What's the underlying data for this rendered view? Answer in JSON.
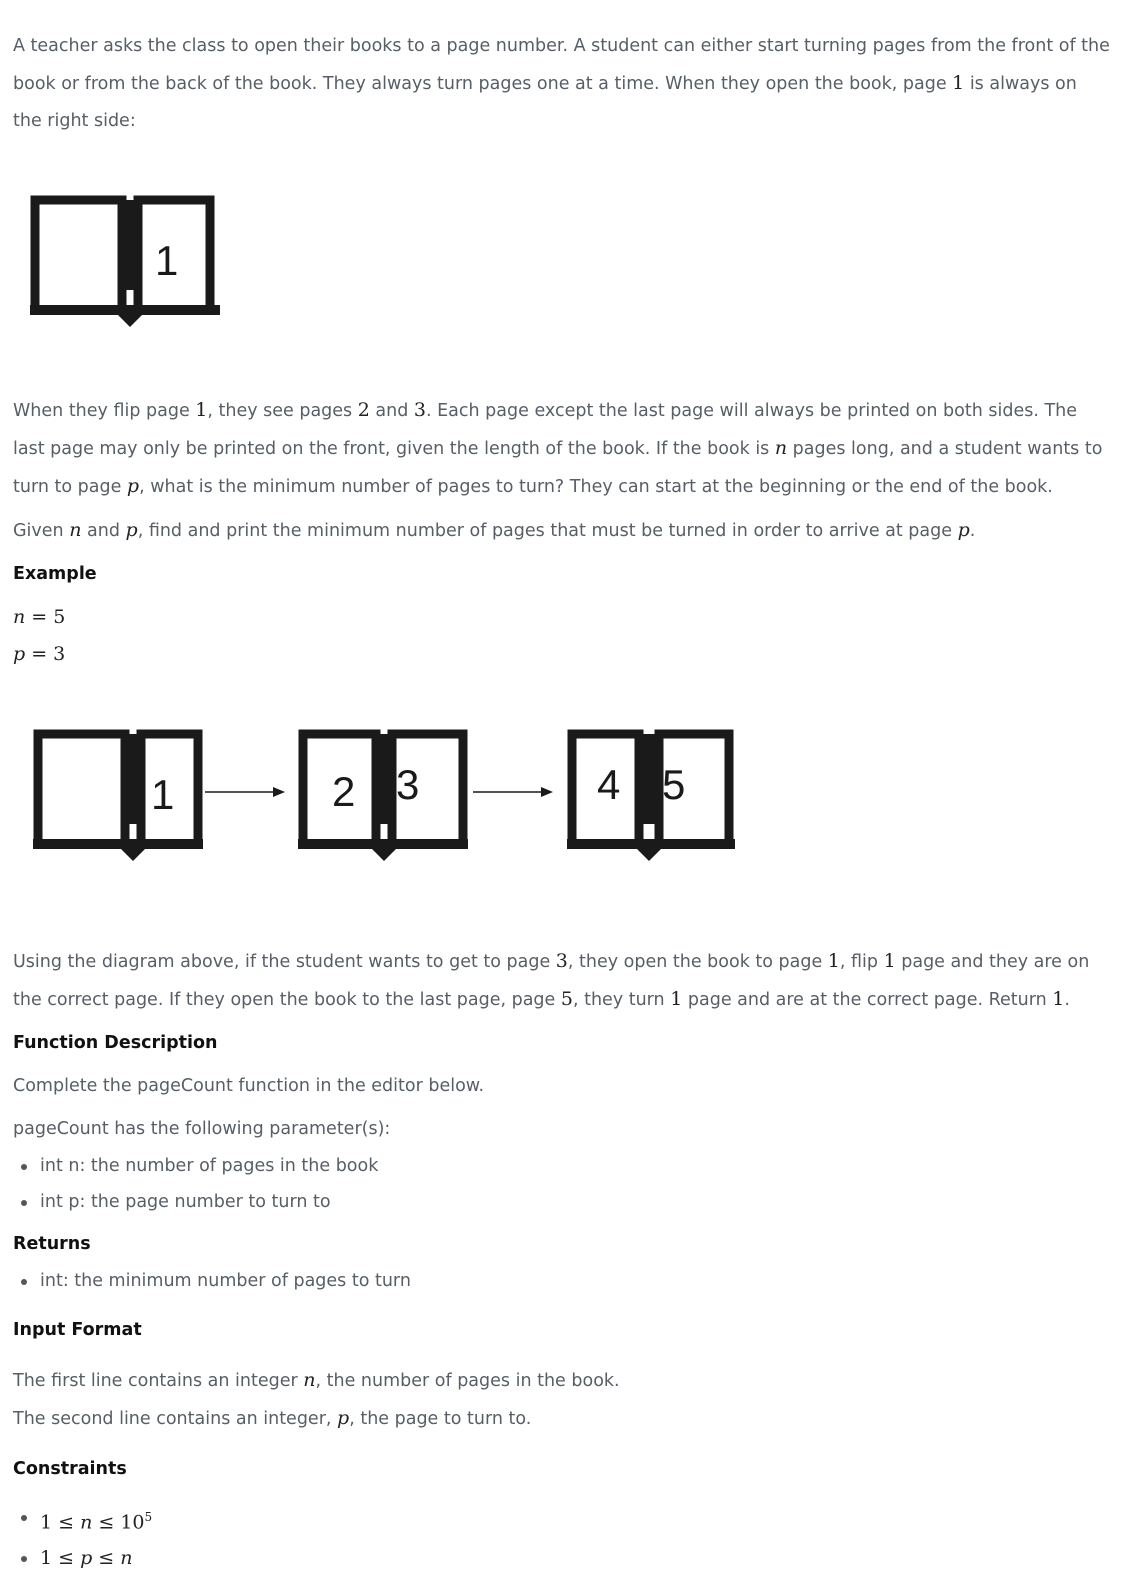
{
  "intro": {
    "p1_a": "A teacher asks the class to open their books to a page number. A student can either start turning pages from the front of the book or from the back of the book. They always turn pages one at a time. When they open the book, page ",
    "p1_num": "1",
    "p1_b": " is always on the right side:"
  },
  "figure1": {
    "page": "1"
  },
  "body": {
    "p2_a": "When they flip page ",
    "p2_1": "1",
    "p2_b": ", they see pages ",
    "p2_2": "2",
    "p2_c": " and ",
    "p2_3": "3",
    "p2_d": ". Each page except the last page will always be printed on both sides. The last page may only be printed on the front, given the length of the book. If the book is ",
    "p2_n": "n",
    "p2_e": " pages long, and a student wants to turn to page ",
    "p2_p": "p",
    "p2_f": ", what is the minimum number of pages to turn? They can start at the beginning or the end of the book.",
    "p3_a": "Given ",
    "p3_n": "n",
    "p3_b": " and ",
    "p3_p": "p",
    "p3_c": ", find and print the minimum number of pages that must be turned in order to arrive at page ",
    "p3_p2": "p",
    "p3_d": "."
  },
  "example": {
    "heading": "Example",
    "n_var": "n",
    "n_eq": " = 5",
    "p_var": "p",
    "p_eq": " = 3"
  },
  "figure2": {
    "book1_right": "1",
    "book2_left": "2",
    "book2_right": "3",
    "book3_left": "4",
    "book3_right": "5"
  },
  "explanation": {
    "a": "Using the diagram above, if the student wants to get to page ",
    "n3": "3",
    "b": ", they open the book to page ",
    "n1": "1",
    "c": ", flip ",
    "n1b": "1",
    "d": " page and they are on the correct page. If they open the book to the last page, page ",
    "n5": "5",
    "e": ", they turn ",
    "n1c": "1",
    "f": " page and are at the correct page. Return ",
    "n1d": "1",
    "g": "."
  },
  "function_description": {
    "heading": "Function Description",
    "line1": "Complete the pageCount function in the editor below.",
    "line2": "pageCount has the following parameter(s):",
    "params": [
      "int n: the number of pages in the book",
      "int p: the page number to turn to"
    ]
  },
  "returns": {
    "heading": "Returns",
    "items": [
      "int: the minimum number of pages to turn"
    ]
  },
  "input_format": {
    "heading": "Input Format",
    "l1_a": "The first line contains an integer ",
    "l1_n": "n",
    "l1_b": ", the number of pages in the book.",
    "l2_a": "The second line contains an integer, ",
    "l2_p": "p",
    "l2_b": ", the page to turn to."
  },
  "constraints": {
    "heading": "Constraints",
    "c1_a": "1 ≤ ",
    "c1_n": "n",
    "c1_b": " ≤ 10",
    "c1_exp": "5",
    "c2_a": "1 ≤ ",
    "c2_p": "p",
    "c2_b": " ≤ ",
    "c2_n": "n"
  }
}
